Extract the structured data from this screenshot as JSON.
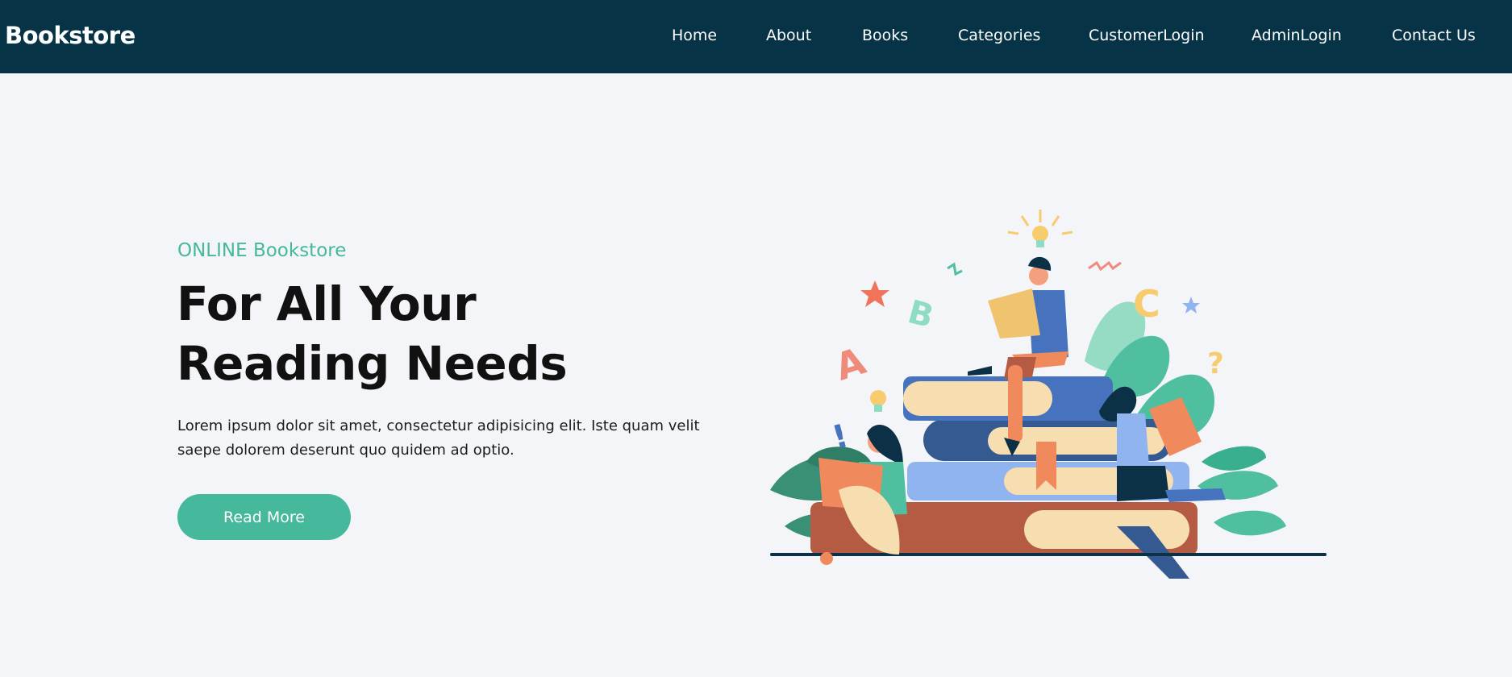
{
  "brand": {
    "name": "Bookstore"
  },
  "nav": {
    "items": [
      {
        "label": "Home"
      },
      {
        "label": "About"
      },
      {
        "label": "Books"
      },
      {
        "label": "Categories"
      },
      {
        "label": "CustomerLogin"
      },
      {
        "label": "AdminLogin"
      },
      {
        "label": "Contact Us"
      }
    ]
  },
  "hero": {
    "eyebrow": "ONLINE Bookstore",
    "title_line1": "For All Your",
    "title_line2": "Reading Needs",
    "description": "Lorem ipsum dolor sit amet, consectetur adipisicing elit. Iste quam velit saepe dolorem deserunt quo quidem ad optio.",
    "cta_label": "Read More",
    "illustration": {
      "icon": "people-reading-books-illustration",
      "letters": [
        "A",
        "B",
        "C"
      ],
      "symbols": [
        "!",
        "?"
      ]
    }
  },
  "colors": {
    "nav_bg": "#073347",
    "page_bg": "#f4f5f9",
    "accent": "#46b89b",
    "text_dark": "#111111"
  }
}
